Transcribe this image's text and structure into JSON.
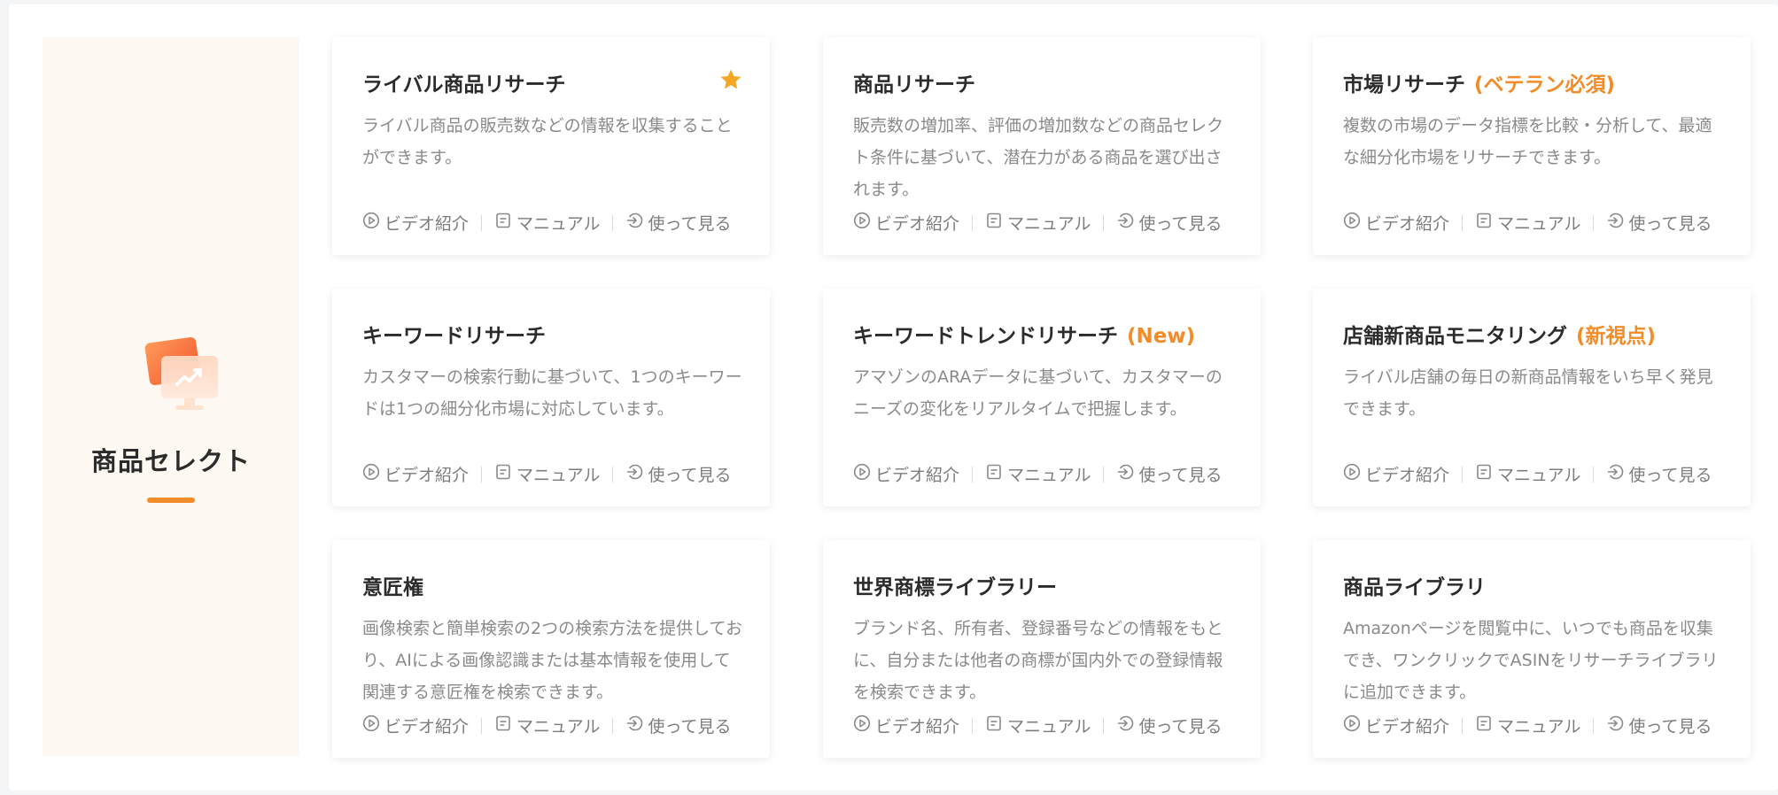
{
  "sidebar": {
    "title": "商品セレクト"
  },
  "colors": {
    "accent": "#f28c28",
    "star": "#f5a623",
    "sidebar_bg": "#fef8f2"
  },
  "card_links": {
    "video": "ビデオ紹介",
    "manual": "マニュアル",
    "try": "使って見る"
  },
  "cards": [
    {
      "title": "ライバル商品リサーチ",
      "tag": "",
      "starred": true,
      "desc": "ライバル商品の販売数などの情報を収集することができます。"
    },
    {
      "title": "商品リサーチ",
      "tag": "",
      "starred": false,
      "desc": "販売数の増加率、評価の増加数などの商品セレクト条件に基づいて、潜在力がある商品を選び出されます。"
    },
    {
      "title": "市場リサーチ",
      "tag": "(ベテラン必須)",
      "starred": false,
      "desc": "複数の市場のデータ指標を比較・分析して、最適な細分化市場をリサーチできます。"
    },
    {
      "title": "キーワードリサーチ",
      "tag": "",
      "starred": false,
      "desc": "カスタマーの検索行動に基づいて、1つのキーワードは1つの細分化市場に対応しています。"
    },
    {
      "title": "キーワードトレンドリサーチ",
      "tag": "(New)",
      "starred": false,
      "desc": "アマゾンのARAデータに基づいて、カスタマーのニーズの変化をリアルタイムで把握します。"
    },
    {
      "title": "店舗新商品モニタリング",
      "tag": "(新視点)",
      "starred": false,
      "desc": "ライバル店舗の毎日の新商品情報をいち早く発見できます。"
    },
    {
      "title": "意匠権",
      "tag": "",
      "starred": false,
      "desc": "画像検索と簡単検索の2つの検索方法を提供しており、AIによる画像認識または基本情報を使用して関連する意匠権を検索できます。"
    },
    {
      "title": "世界商標ライブラリー",
      "tag": "",
      "starred": false,
      "desc": "ブランド名、所有者、登録番号などの情報をもとに、自分または他者の商標が国内外での登録情報を検索できます。"
    },
    {
      "title": "商品ライブラリ",
      "tag": "",
      "starred": false,
      "desc": "Amazonページを閲覧中に、いつでも商品を収集でき、ワンクリックでASINをリサーチライブラリに追加できます。"
    }
  ]
}
